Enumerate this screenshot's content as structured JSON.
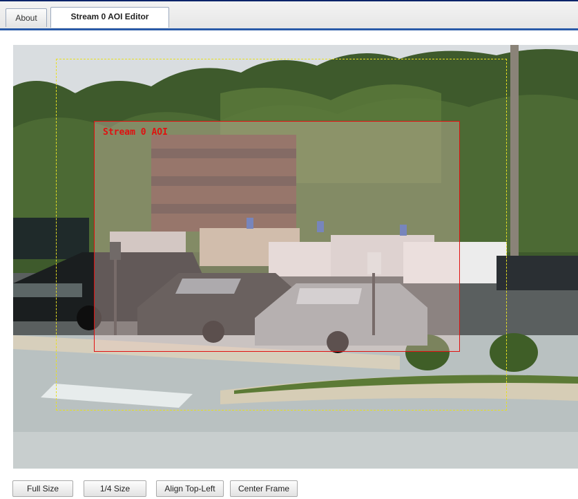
{
  "tabs": [
    {
      "label": "About",
      "active": false
    },
    {
      "label": "Stream 0 AOI Editor",
      "active": true
    }
  ],
  "viewer": {
    "aoi_label": "Stream 0 AOI",
    "aoi_color": "#e01010",
    "frame_color": "#e8e020"
  },
  "buttons": {
    "full_size": "Full Size",
    "quarter_size": "1/4 Size",
    "align_top_left": "Align Top-Left",
    "center_frame": "Center Frame"
  }
}
